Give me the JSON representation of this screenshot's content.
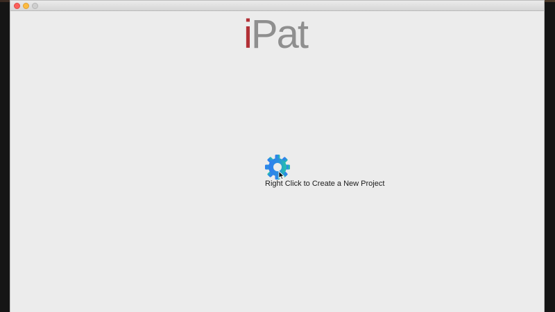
{
  "app": {
    "logo_first_letter": "i",
    "logo_rest": "Pat",
    "logo_colors": {
      "i": "#b23036",
      "rest": "#8f8f8f"
    }
  },
  "window": {
    "controls": [
      "close-icon",
      "minimize-icon",
      "zoom-icon"
    ]
  },
  "main": {
    "hint_icon": "gear-icon",
    "hint_text": "Right Click to Create a New Project",
    "cursor_icon": "arrow-pointer-icon"
  }
}
